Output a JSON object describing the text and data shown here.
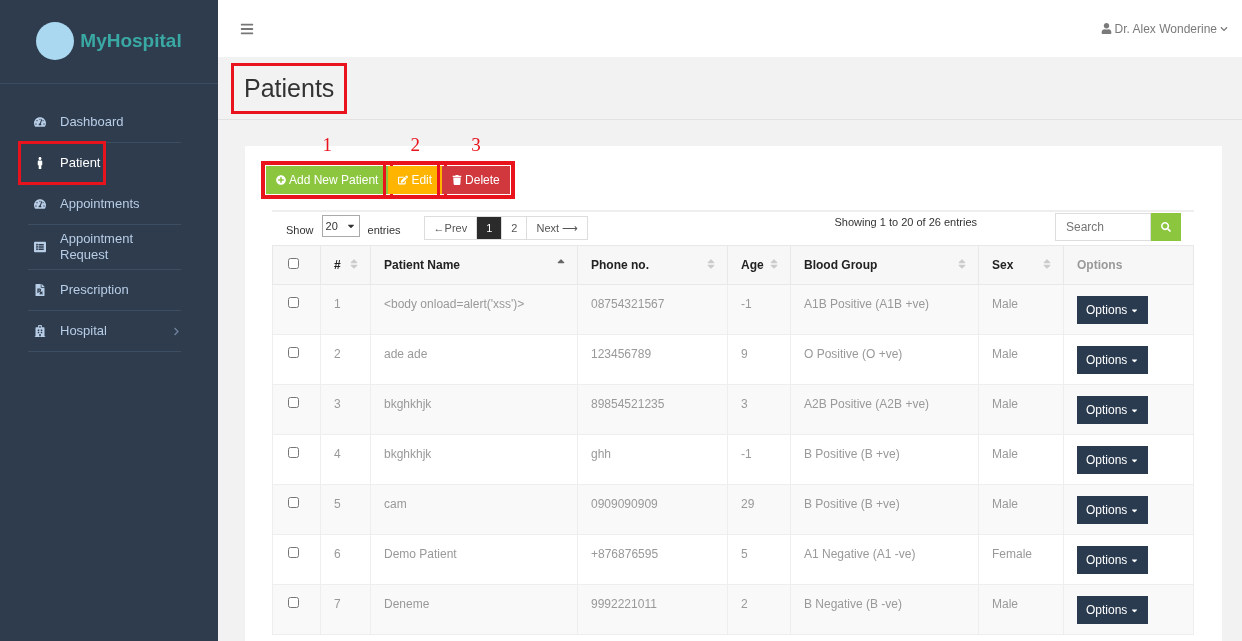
{
  "brand": {
    "name": "MyHospital"
  },
  "sidebar": {
    "items": [
      {
        "label": "Dashboard",
        "selected": false,
        "highlighted": false,
        "has_children": false
      },
      {
        "label": "Patient",
        "selected": true,
        "highlighted": true,
        "has_children": false
      },
      {
        "label": "Appointments",
        "selected": false,
        "highlighted": false,
        "has_children": false
      },
      {
        "label": "Appointment Request",
        "selected": false,
        "highlighted": false,
        "has_children": false
      },
      {
        "label": "Prescription",
        "selected": false,
        "highlighted": false,
        "has_children": false
      },
      {
        "label": "Hospital",
        "selected": false,
        "highlighted": false,
        "has_children": true
      }
    ]
  },
  "topbar": {
    "user": "Dr. Alex Wonderine"
  },
  "page": {
    "title": "Patients",
    "highlighted": true
  },
  "toolbar": {
    "highlighted": true,
    "buttons": [
      {
        "label": "Add New Patient",
        "kind": "add",
        "marker": "1"
      },
      {
        "label": "Edit",
        "kind": "edit",
        "marker": "2"
      },
      {
        "label": "Delete",
        "kind": "delete",
        "marker": "3"
      }
    ]
  },
  "table_controls": {
    "show_label": "Show",
    "page_size": "20",
    "entries_label": "entries",
    "pagination": [
      {
        "label": "←Prev",
        "selected": false
      },
      {
        "label": "1",
        "selected": true
      },
      {
        "label": "2",
        "selected": false
      },
      {
        "label": "Next ⟶",
        "selected": false
      }
    ],
    "info": "Showing 1 to 20 of 26 entries",
    "search": {
      "placeholder": "Search"
    }
  },
  "table": {
    "select_all_checked": false,
    "columns": [
      {
        "label": "#",
        "sortable": true
      },
      {
        "label": "Patient Name",
        "sortable": true,
        "sorted": true
      },
      {
        "label": "Phone no.",
        "sortable": true
      },
      {
        "label": "Age",
        "sortable": true
      },
      {
        "label": "Blood Group",
        "sortable": true
      },
      {
        "label": "Sex",
        "sortable": true
      },
      {
        "label": "Options",
        "sortable": false
      }
    ],
    "rows": [
      {
        "checked": false,
        "cells": [
          "1",
          "<body onload=alert('xss')>",
          "08754321567",
          "-1",
          "A1B Positive (A1B +ve)",
          "Male"
        ],
        "action": "Options"
      },
      {
        "checked": false,
        "cells": [
          "2",
          "ade ade",
          "123456789",
          "9",
          "O Positive (O +ve)",
          "Male"
        ],
        "action": "Options"
      },
      {
        "checked": false,
        "cells": [
          "3",
          "bkghkhjk",
          "89854521235",
          "3",
          "A2B Positive (A2B +ve)",
          "Male"
        ],
        "action": "Options"
      },
      {
        "checked": false,
        "cells": [
          "4",
          "bkghkhjk",
          "ghh",
          "-1",
          "B Positive (B +ve)",
          "Male"
        ],
        "action": "Options"
      },
      {
        "checked": false,
        "cells": [
          "5",
          "cam",
          "0909090909",
          "29",
          "B Positive (B +ve)",
          "Male"
        ],
        "action": "Options"
      },
      {
        "checked": false,
        "cells": [
          "6",
          "Demo Patient",
          "+876876595",
          "5",
          "A1 Negative (A1 -ve)",
          "Female"
        ],
        "action": "Options"
      },
      {
        "checked": false,
        "cells": [
          "7",
          "Deneme",
          "9992221011",
          "2",
          "B Negative (B -ve)",
          "Male"
        ],
        "action": "Options"
      }
    ]
  }
}
